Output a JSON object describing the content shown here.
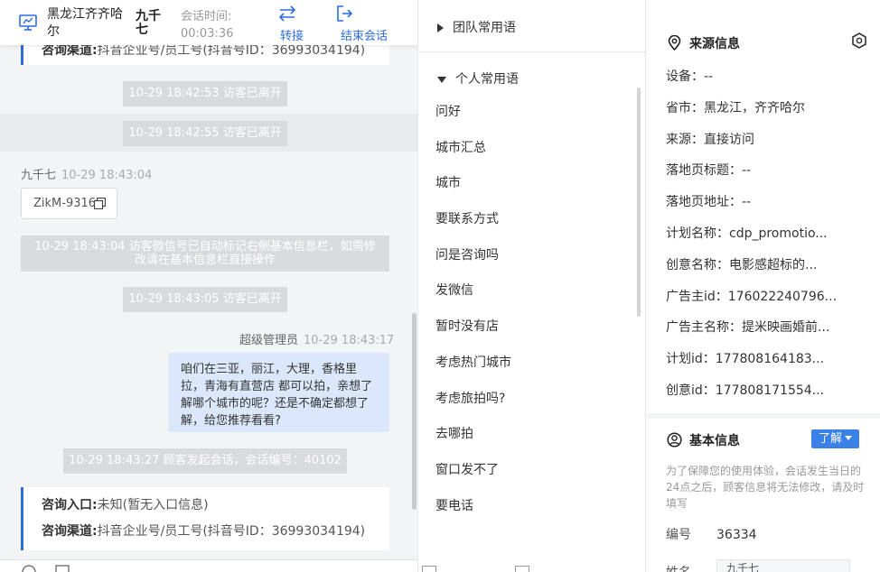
{
  "header": {
    "location": "黑龙江齐齐哈尔",
    "visitor_name": "九千七",
    "session_time_label": "会话时间:",
    "session_time": "00:03:36",
    "transfer_label": "转接",
    "end_label": "结束会话"
  },
  "chat": {
    "top_card_channel_key": "咨询渠道:",
    "top_card_channel_value": "抖音企业号/员工号(抖音号ID：36993034194)",
    "sys1": "10-29 18:42:53 访客已离开",
    "sys2": "10-29 18:42:55 访客已离开",
    "visitor_sender": "九千七",
    "visitor_time": "10-29 18:43:04",
    "code_chip": "ZikM-9316",
    "sys3": "10-29 18:43:04 访客微信号已自动标记右侧基本信息栏，如需修改请在基本信息栏直接操作",
    "sys4": "10-29 18:43:05 访客已离开",
    "agent_sender": "超级管理员",
    "agent_time": "10-29 18:43:17",
    "agent_message": "咱们在三亚，丽江，大理，香格里拉，青海有直营店 都可以拍，亲想了解哪个城市的呢？还是不确定都想了解，给您推荐看看?",
    "sys5": "10-29 18:43:27 顾客发起会话，会话编号：40102",
    "bottom_card_entry_key": "咨询入口:",
    "bottom_card_entry_value": "未知(暂无入口信息)",
    "bottom_card_channel_key": "咨询渠道:",
    "bottom_card_channel_value": "抖音企业号/员工号(抖音号ID：36993034194)"
  },
  "phrases": {
    "team_group": "团队常用语",
    "personal_group": "个人常用语",
    "items": [
      "问好",
      "城市汇总",
      "城市",
      "要联系方式",
      "问是咨询吗",
      "发微信",
      "暂时没有店",
      "考虑热门城市",
      "考虑旅拍吗?",
      "去哪拍",
      "窗口发不了",
      "要电话"
    ]
  },
  "info": {
    "source_title": "来源信息",
    "rows": [
      "设备：--",
      "省市：黑龙江，齐齐哈尔",
      "来源：直接访问",
      "落地页标题：--",
      "落地页地址：--",
      "计划名称：cdp_promotio...",
      "创意名称：电影感超标的...",
      "广告主id：176022240796...",
      "广告主名称：提米映画婚前...",
      "计划id：177808164183...",
      "创意id：177808171554..."
    ],
    "basic_title": "基本信息",
    "know_button": "了解",
    "notice": "为了保障您的使用体验，会话发生当日的24点之后，顾客信息将无法修改，请及时填写",
    "id_key": "编号",
    "id_value": "36334",
    "name_key": "姓名",
    "name_value": "九千七"
  },
  "colors": {
    "accent": "#2b6cde",
    "agent_bubble": "#dbe8fb",
    "system_msg": "#d9dadc"
  }
}
